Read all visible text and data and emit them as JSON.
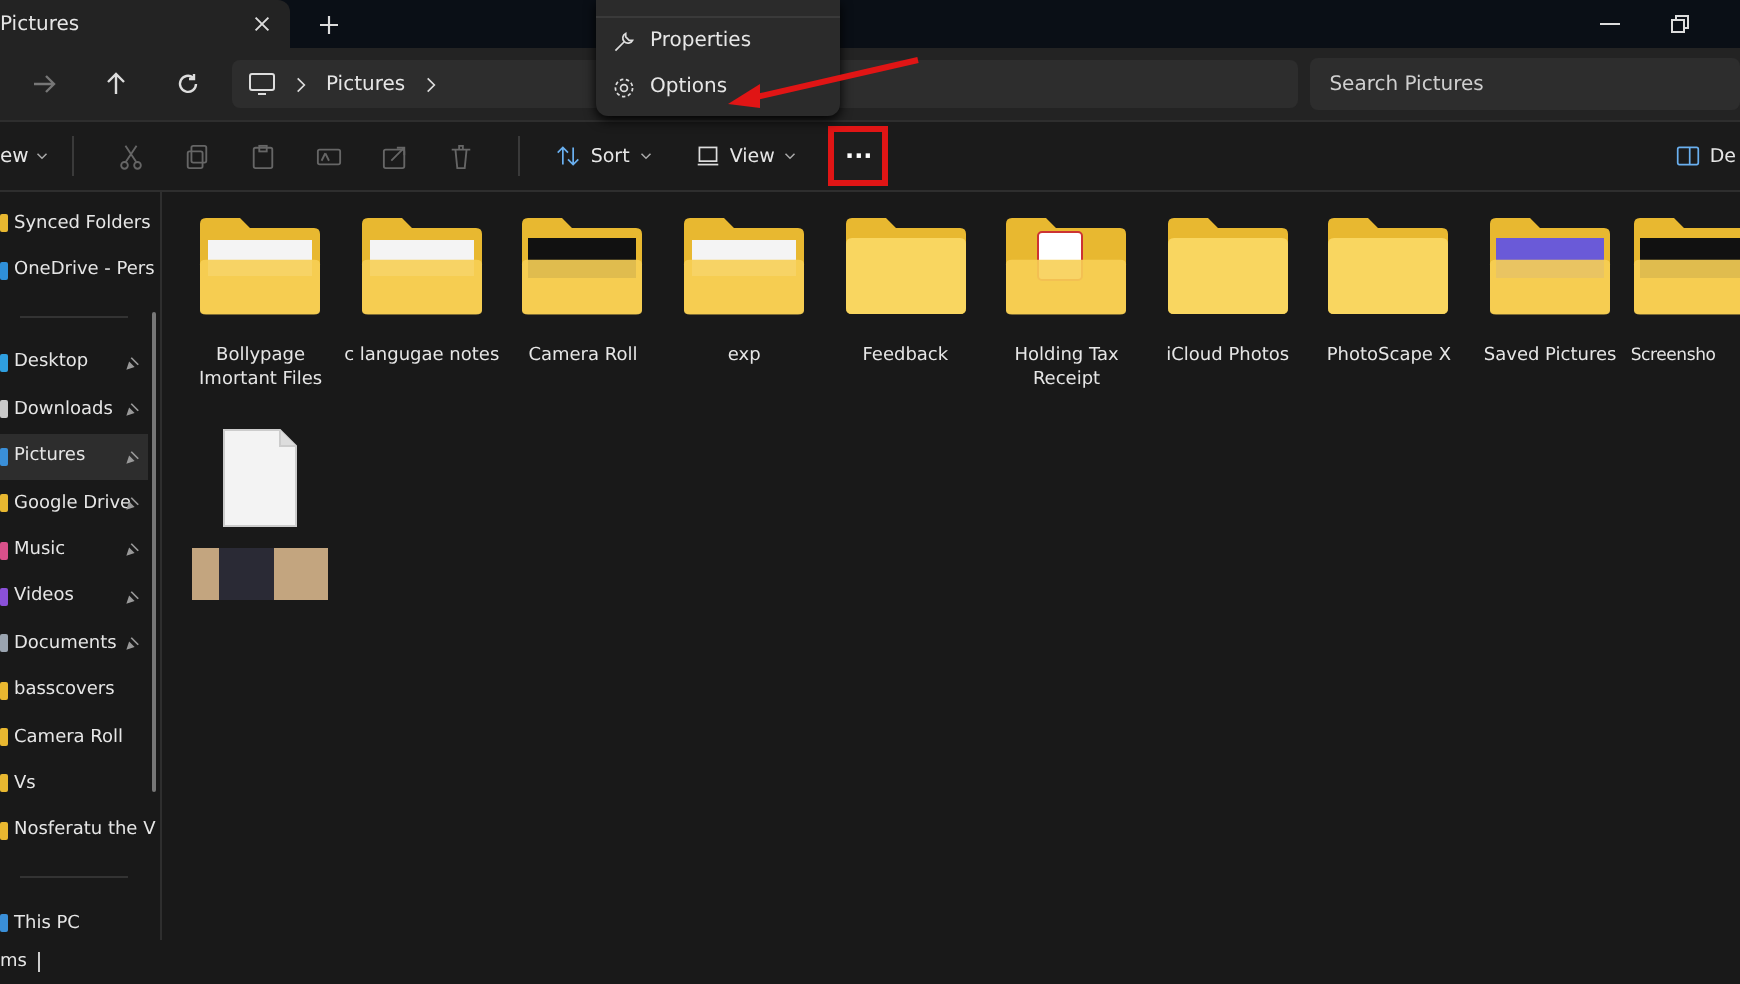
{
  "window": {
    "tab_title": "Pictures"
  },
  "address": {
    "crumbs": [
      "Pictures"
    ],
    "search_placeholder": "Search Pictures"
  },
  "menu": {
    "items": [
      {
        "label": "Properties",
        "kind": "wrench"
      },
      {
        "label": "Options",
        "kind": "gear"
      }
    ]
  },
  "toolbar": {
    "new_label": "ew",
    "sort_label": "Sort",
    "view_label": "View",
    "more_label": "···",
    "details_label": "De"
  },
  "sidebar": {
    "groups": [
      [
        {
          "label": "Synced Folders",
          "color": "#e8b730",
          "selected": false,
          "pinned": false
        },
        {
          "label": "OneDrive - Pers",
          "color": "#2f8fd8",
          "selected": false,
          "pinned": false
        }
      ],
      [
        {
          "label": "Desktop",
          "color": "#2f9fe0",
          "selected": false,
          "pinned": true
        },
        {
          "label": "Downloads",
          "color": "#c9c9c9",
          "selected": false,
          "pinned": true
        },
        {
          "label": "Pictures",
          "color": "#3a8fd8",
          "selected": true,
          "pinned": true
        },
        {
          "label": "Google Drive",
          "color": "#e8b730",
          "selected": false,
          "pinned": true
        },
        {
          "label": "Music",
          "color": "#d8508a",
          "selected": false,
          "pinned": true
        },
        {
          "label": "Videos",
          "color": "#8a50d8",
          "selected": false,
          "pinned": true
        },
        {
          "label": "Documents",
          "color": "#9aa4b0",
          "selected": false,
          "pinned": true
        },
        {
          "label": "basscovers",
          "color": "#e8b730",
          "selected": false,
          "pinned": false
        },
        {
          "label": "Camera Roll",
          "color": "#e8b730",
          "selected": false,
          "pinned": false
        },
        {
          "label": "Vs",
          "color": "#e8b730",
          "selected": false,
          "pinned": false
        },
        {
          "label": "Nosferatu the V",
          "color": "#e8b730",
          "selected": false,
          "pinned": false
        }
      ],
      [
        {
          "label": "This PC",
          "color": "#3a8fd8",
          "selected": false,
          "pinned": false
        }
      ]
    ]
  },
  "items": [
    {
      "name": "Bollypage Imortant Files",
      "kind": "sheet"
    },
    {
      "name": "c langugae notes",
      "kind": "sheet"
    },
    {
      "name": "Camera Roll",
      "kind": "dark"
    },
    {
      "name": "exp",
      "kind": "sheet"
    },
    {
      "name": "Feedback",
      "kind": "plain"
    },
    {
      "name": "Holding Tax Receipt",
      "kind": "pdf"
    },
    {
      "name": "iCloud Photos",
      "kind": "plain"
    },
    {
      "name": "PhotoScape X",
      "kind": "plain"
    },
    {
      "name": "Saved Pictures",
      "kind": "photo"
    },
    {
      "name": "Screensho",
      "kind": "dark"
    },
    {
      "kind": "file"
    }
  ],
  "status_bar": {
    "text": "ms"
  }
}
